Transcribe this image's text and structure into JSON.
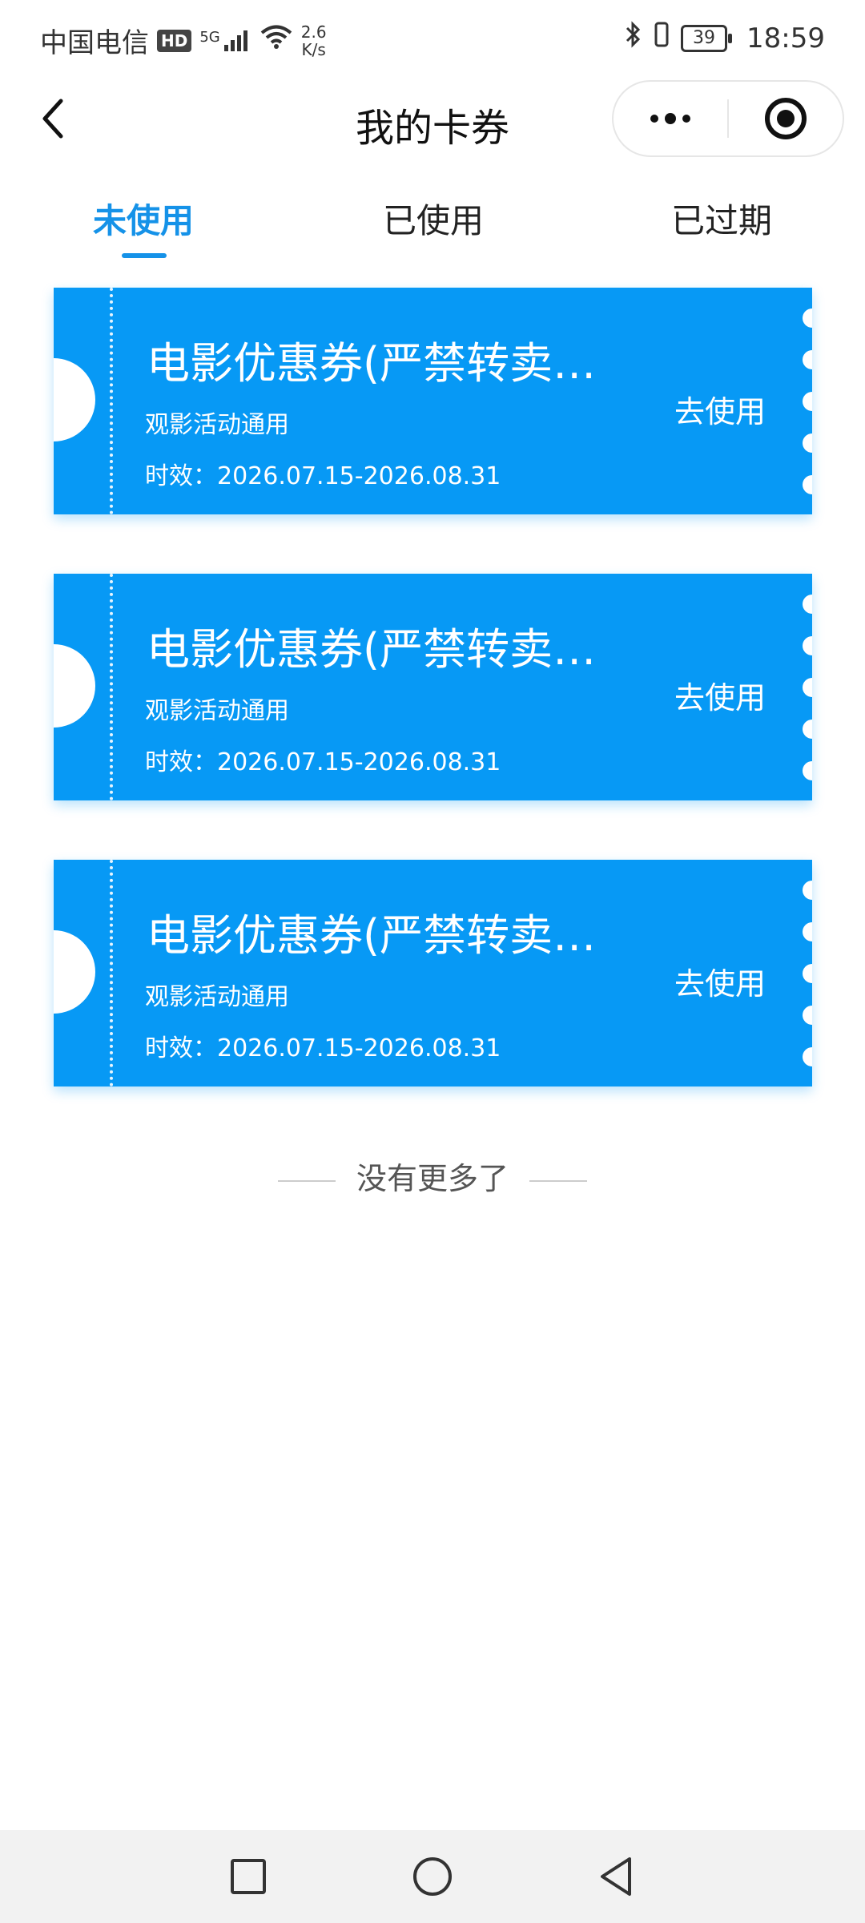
{
  "status_bar": {
    "carrier": "中国电信",
    "hd": "HD",
    "network": "5G",
    "speed_value": "2.6",
    "speed_unit": "K/s",
    "battery": "39",
    "time": "18:59"
  },
  "nav": {
    "title": "我的卡券"
  },
  "tabs": [
    {
      "label": "未使用",
      "active": true
    },
    {
      "label": "已使用",
      "active": false
    },
    {
      "label": "已过期",
      "active": false
    }
  ],
  "coupons": [
    {
      "title": "电影优惠券(严禁转卖…",
      "subtitle": "观影活动通用",
      "validity": "时效：2026.07.15-2026.08.31",
      "action": "去使用"
    },
    {
      "title": "电影优惠券(严禁转卖…",
      "subtitle": "观影活动通用",
      "validity": "时效：2026.07.15-2026.08.31",
      "action": "去使用"
    },
    {
      "title": "电影优惠券(严禁转卖…",
      "subtitle": "观影活动通用",
      "validity": "时效：2026.07.15-2026.08.31",
      "action": "去使用"
    }
  ],
  "footer": {
    "no_more": "没有更多了"
  },
  "colors": {
    "accent": "#1592e8",
    "coupon_bg": "#0799f5"
  }
}
